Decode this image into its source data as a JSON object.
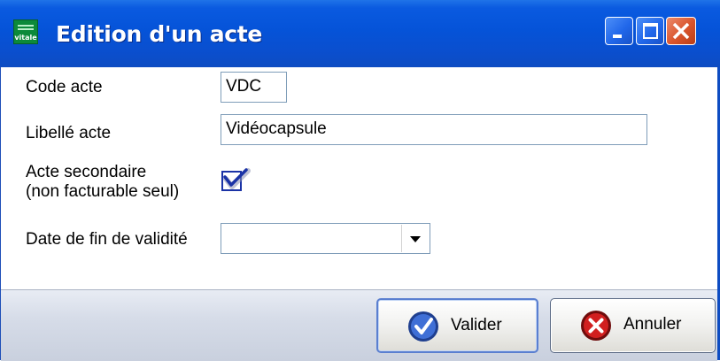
{
  "window": {
    "title": "Edition d'un acte",
    "icon": "vitale-app-icon",
    "icon_text": "vitale",
    "controls": [
      "minimize-icon",
      "maximize-icon",
      "close-icon"
    ]
  },
  "form": {
    "code_label": "Code acte",
    "code_value": "VDC",
    "libelle_label": "Libellé acte",
    "libelle_value": "Vidéocapsule",
    "secondaire_label_line1": "Acte secondaire",
    "secondaire_label_line2": "(non facturable seul)",
    "secondaire_checked": true,
    "date_label": "Date de fin de validité",
    "date_value": ""
  },
  "buttons": {
    "valider_label": "Valider",
    "annuler_label": "Annuler"
  },
  "colors": {
    "titlebar": "#0553d8",
    "close": "#d9542c"
  }
}
